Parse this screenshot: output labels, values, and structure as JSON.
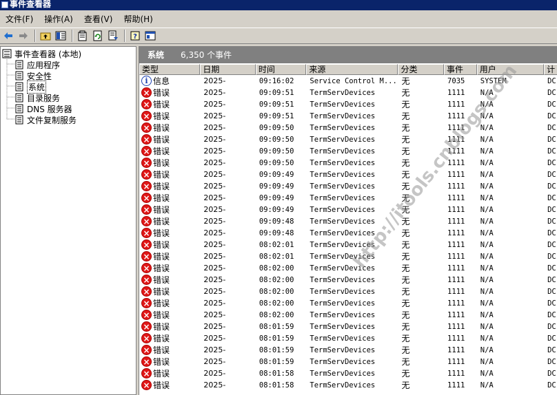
{
  "window": {
    "title": "事件查看器"
  },
  "menu": [
    {
      "label": "文件(F)"
    },
    {
      "label": "操作(A)"
    },
    {
      "label": "查看(V)"
    },
    {
      "label": "帮助(H)"
    }
  ],
  "toolbar": {
    "icons": [
      "back-arrow-icon",
      "forward-arrow-icon",
      "up-folder-icon",
      "show-hide-tree-icon",
      "properties-icon",
      "refresh-icon",
      "export-list-icon",
      "help-icon",
      "console-icon"
    ]
  },
  "tree": {
    "root": "事件查看器 (本地)",
    "items": [
      {
        "label": "应用程序"
      },
      {
        "label": "安全性"
      },
      {
        "label": "系统"
      },
      {
        "label": "目录服务"
      },
      {
        "label": "DNS 服务器"
      },
      {
        "label": "文件复制服务"
      }
    ]
  },
  "pane": {
    "title": "系统",
    "count": "6,350 个事件"
  },
  "columns": [
    "类型",
    "日期",
    "时间",
    "来源",
    "分类",
    "事件",
    "用户",
    "计"
  ],
  "events": [
    {
      "type": "信息",
      "date": "2025-",
      "time": "09:16:02",
      "source": "Service Control M...",
      "category": "无",
      "event": "7035",
      "user": "SYSTEM",
      "computer": "DC"
    },
    {
      "type": "错误",
      "date": "2025-",
      "time": "09:09:51",
      "source": "TermServDevices",
      "category": "无",
      "event": "1111",
      "user": "N/A",
      "computer": "DC"
    },
    {
      "type": "错误",
      "date": "2025-",
      "time": "09:09:51",
      "source": "TermServDevices",
      "category": "无",
      "event": "1111",
      "user": "N/A",
      "computer": "DC"
    },
    {
      "type": "错误",
      "date": "2025-",
      "time": "09:09:51",
      "source": "TermServDevices",
      "category": "无",
      "event": "1111",
      "user": "N/A",
      "computer": "DC"
    },
    {
      "type": "错误",
      "date": "2025-",
      "time": "09:09:50",
      "source": "TermServDevices",
      "category": "无",
      "event": "1111",
      "user": "N/A",
      "computer": "DC"
    },
    {
      "type": "错误",
      "date": "2025-",
      "time": "09:09:50",
      "source": "TermServDevices",
      "category": "无",
      "event": "1111",
      "user": "N/A",
      "computer": "DC"
    },
    {
      "type": "错误",
      "date": "2025-",
      "time": "09:09:50",
      "source": "TermServDevices",
      "category": "无",
      "event": "1111",
      "user": "N/A",
      "computer": "DC"
    },
    {
      "type": "错误",
      "date": "2025-",
      "time": "09:09:50",
      "source": "TermServDevices",
      "category": "无",
      "event": "1111",
      "user": "N/A",
      "computer": "DC"
    },
    {
      "type": "错误",
      "date": "2025-",
      "time": "09:09:49",
      "source": "TermServDevices",
      "category": "无",
      "event": "1111",
      "user": "N/A",
      "computer": "DC"
    },
    {
      "type": "错误",
      "date": "2025-",
      "time": "09:09:49",
      "source": "TermServDevices",
      "category": "无",
      "event": "1111",
      "user": "N/A",
      "computer": "DC"
    },
    {
      "type": "错误",
      "date": "2025-",
      "time": "09:09:49",
      "source": "TermServDevices",
      "category": "无",
      "event": "1111",
      "user": "N/A",
      "computer": "DC"
    },
    {
      "type": "错误",
      "date": "2025-",
      "time": "09:09:49",
      "source": "TermServDevices",
      "category": "无",
      "event": "1111",
      "user": "N/A",
      "computer": "DC"
    },
    {
      "type": "错误",
      "date": "2025-",
      "time": "09:09:48",
      "source": "TermServDevices",
      "category": "无",
      "event": "1111",
      "user": "N/A",
      "computer": "DC"
    },
    {
      "type": "错误",
      "date": "2025-",
      "time": "09:09:48",
      "source": "TermServDevices",
      "category": "无",
      "event": "1111",
      "user": "N/A",
      "computer": "DC"
    },
    {
      "type": "错误",
      "date": "2025-",
      "time": "08:02:01",
      "source": "TermServDevices",
      "category": "无",
      "event": "1111",
      "user": "N/A",
      "computer": "DC"
    },
    {
      "type": "错误",
      "date": "2025-",
      "time": "08:02:01",
      "source": "TermServDevices",
      "category": "无",
      "event": "1111",
      "user": "N/A",
      "computer": "DC"
    },
    {
      "type": "错误",
      "date": "2025-",
      "time": "08:02:00",
      "source": "TermServDevices",
      "category": "无",
      "event": "1111",
      "user": "N/A",
      "computer": "DC"
    },
    {
      "type": "错误",
      "date": "2025-",
      "time": "08:02:00",
      "source": "TermServDevices",
      "category": "无",
      "event": "1111",
      "user": "N/A",
      "computer": "DC"
    },
    {
      "type": "错误",
      "date": "2025-",
      "time": "08:02:00",
      "source": "TermServDevices",
      "category": "无",
      "event": "1111",
      "user": "N/A",
      "computer": "DC"
    },
    {
      "type": "错误",
      "date": "2025-",
      "time": "08:02:00",
      "source": "TermServDevices",
      "category": "无",
      "event": "1111",
      "user": "N/A",
      "computer": "DC"
    },
    {
      "type": "错误",
      "date": "2025-",
      "time": "08:02:00",
      "source": "TermServDevices",
      "category": "无",
      "event": "1111",
      "user": "N/A",
      "computer": "DC"
    },
    {
      "type": "错误",
      "date": "2025-",
      "time": "08:01:59",
      "source": "TermServDevices",
      "category": "无",
      "event": "1111",
      "user": "N/A",
      "computer": "DC"
    },
    {
      "type": "错误",
      "date": "2025-",
      "time": "08:01:59",
      "source": "TermServDevices",
      "category": "无",
      "event": "1111",
      "user": "N/A",
      "computer": "DC"
    },
    {
      "type": "错误",
      "date": "2025-",
      "time": "08:01:59",
      "source": "TermServDevices",
      "category": "无",
      "event": "1111",
      "user": "N/A",
      "computer": "DC"
    },
    {
      "type": "错误",
      "date": "2025-",
      "time": "08:01:59",
      "source": "TermServDevices",
      "category": "无",
      "event": "1111",
      "user": "N/A",
      "computer": "DC"
    },
    {
      "type": "错误",
      "date": "2025-",
      "time": "08:01:58",
      "source": "TermServDevices",
      "category": "无",
      "event": "1111",
      "user": "N/A",
      "computer": "DC"
    },
    {
      "type": "错误",
      "date": "2025-",
      "time": "08:01:58",
      "source": "TermServDevices",
      "category": "无",
      "event": "1111",
      "user": "N/A",
      "computer": "DC"
    }
  ],
  "watermark": "http://itools.cnblogs.com"
}
